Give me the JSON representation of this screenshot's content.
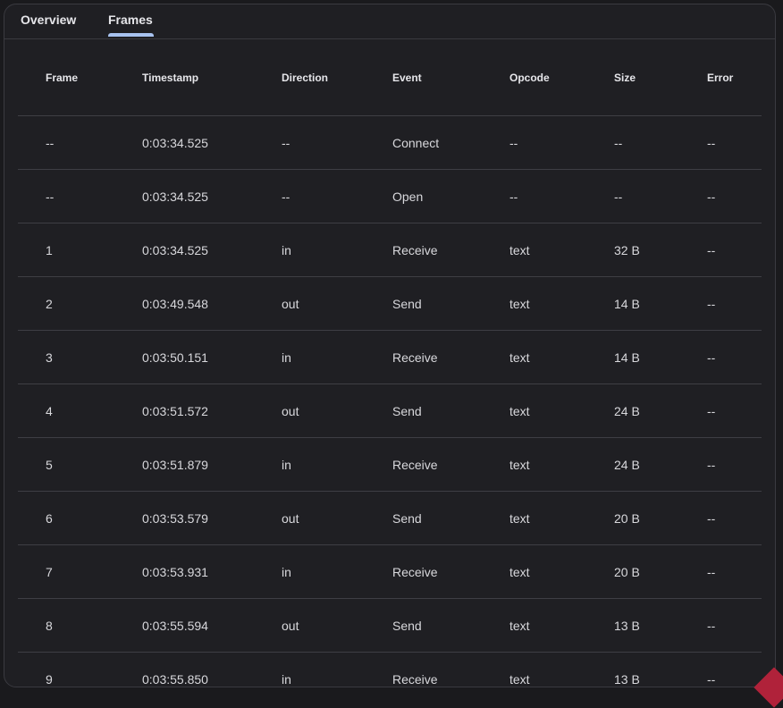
{
  "tabs": [
    {
      "label": "Overview",
      "active": false
    },
    {
      "label": "Frames",
      "active": true
    }
  ],
  "accent_color": "#a8c3f0",
  "table": {
    "columns": [
      "Frame",
      "Timestamp",
      "Direction",
      "Event",
      "Opcode",
      "Size",
      "Error"
    ],
    "rows": [
      [
        "--",
        "0:03:34.525",
        "--",
        "Connect",
        "--",
        "--",
        "--"
      ],
      [
        "--",
        "0:03:34.525",
        "--",
        "Open",
        "--",
        "--",
        "--"
      ],
      [
        "1",
        "0:03:34.525",
        "in",
        "Receive",
        "text",
        "32 B",
        "--"
      ],
      [
        "2",
        "0:03:49.548",
        "out",
        "Send",
        "text",
        "14 B",
        "--"
      ],
      [
        "3",
        "0:03:50.151",
        "in",
        "Receive",
        "text",
        "14 B",
        "--"
      ],
      [
        "4",
        "0:03:51.572",
        "out",
        "Send",
        "text",
        "24 B",
        "--"
      ],
      [
        "5",
        "0:03:51.879",
        "in",
        "Receive",
        "text",
        "24 B",
        "--"
      ],
      [
        "6",
        "0:03:53.579",
        "out",
        "Send",
        "text",
        "20 B",
        "--"
      ],
      [
        "7",
        "0:03:53.931",
        "in",
        "Receive",
        "text",
        "20 B",
        "--"
      ],
      [
        "8",
        "0:03:55.594",
        "out",
        "Send",
        "text",
        "13 B",
        "--"
      ],
      [
        "9",
        "0:03:55.850",
        "in",
        "Receive",
        "text",
        "13 B",
        "--"
      ]
    ]
  }
}
